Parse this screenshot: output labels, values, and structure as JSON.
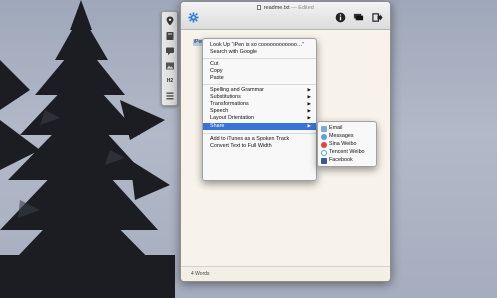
{
  "window": {
    "filename": "readme.txt",
    "status": "— Edited"
  },
  "toolbar": {
    "settings_icon": "gear-icon",
    "info_icon": "info-icon",
    "stack_icon": "stack-icon",
    "export_icon": "export-icon"
  },
  "palette": {
    "icons": [
      "map-pin-icon",
      "book-icon",
      "chat-icon",
      "image-icon",
      "heading-icon",
      "list-icon"
    ],
    "heading_text": "H2"
  },
  "document": {
    "selected_text": "iPen"
  },
  "status": {
    "word_count": "4 Words"
  },
  "context_menu": {
    "look_up": "Look Up “iPen is so coooooooooooo…”",
    "search_google": "Search with Google",
    "cut": "Cut",
    "copy": "Copy",
    "paste": "Paste",
    "spelling": "Spelling and Grammar",
    "substitutions": "Substitutions",
    "transformations": "Transformations",
    "speech": "Speech",
    "layout_orientation": "Layout Orientation",
    "share": "Share",
    "itunes": "Add to iTunes as a Spoken Track",
    "full_width": "Convert Text to Full Width",
    "arrow": "▶"
  },
  "share_menu": {
    "email": "Email",
    "messages": "Messages",
    "sina": "Sina Weibo",
    "tencent": "Tencent Weibo",
    "facebook": "Facebook"
  },
  "colors": {
    "highlight": "#3a73d6",
    "selection": "#b7cde8",
    "paper": "#f7f3ea"
  }
}
